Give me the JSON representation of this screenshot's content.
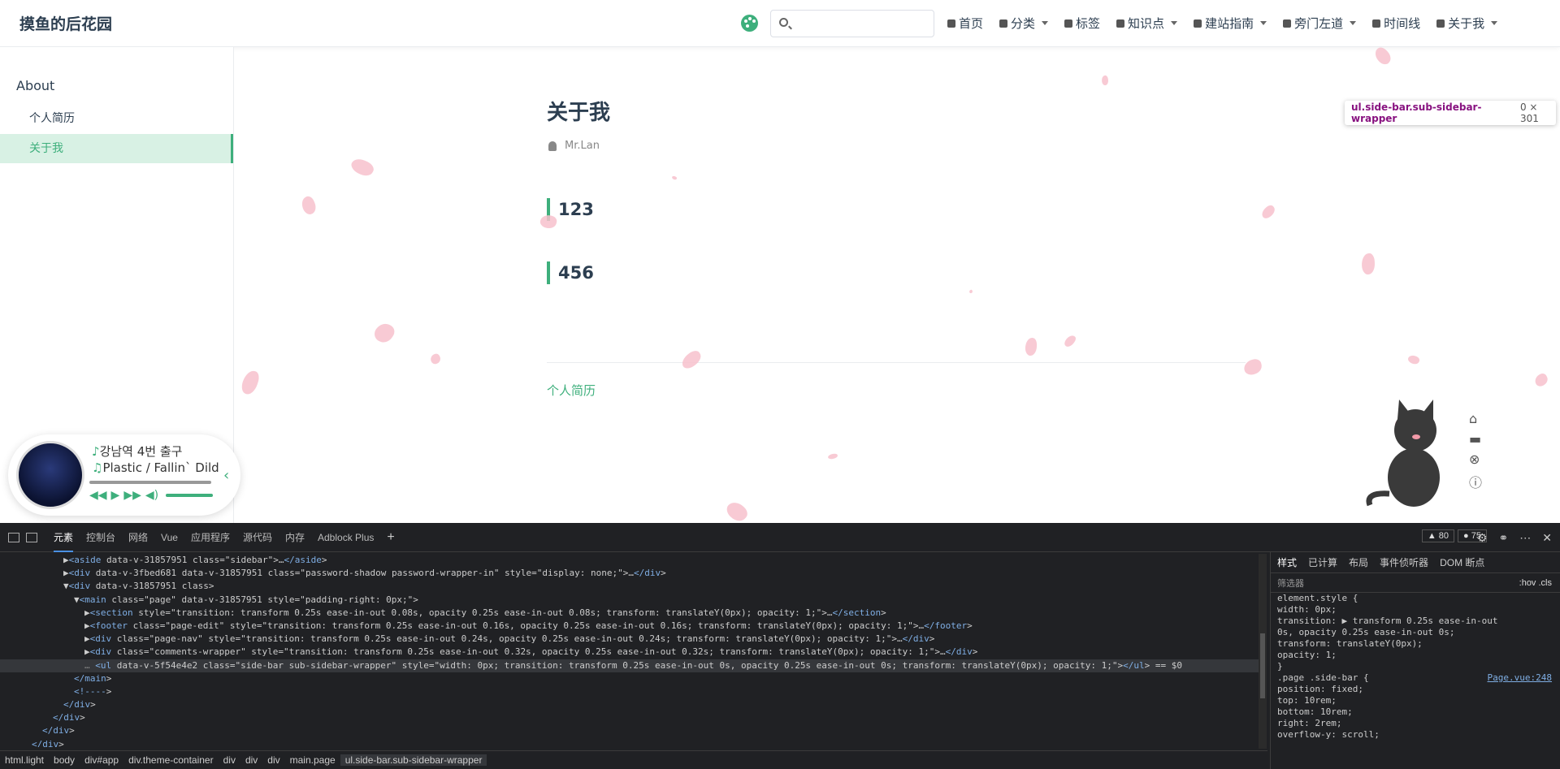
{
  "navbar": {
    "site_name": "摸鱼的后花园",
    "search_placeholder": "",
    "links": [
      {
        "label": "首页",
        "dropdown": false
      },
      {
        "label": "分类",
        "dropdown": true
      },
      {
        "label": "标签",
        "dropdown": false
      },
      {
        "label": "知识点",
        "dropdown": true
      },
      {
        "label": "建站指南",
        "dropdown": true
      },
      {
        "label": "旁门左道",
        "dropdown": true
      },
      {
        "label": "时间线",
        "dropdown": false
      },
      {
        "label": "关于我",
        "dropdown": true
      }
    ]
  },
  "sidebar": {
    "title": "About",
    "items": [
      {
        "label": "个人简历",
        "active": false
      },
      {
        "label": "关于我",
        "active": true
      }
    ]
  },
  "main": {
    "title": "关于我",
    "author": "Mr.Lan",
    "headings": [
      "123",
      "456"
    ],
    "prev_link": "个人简历"
  },
  "player": {
    "song": "강남역 4번 출구",
    "artist": "Plastic / Fallin` Dild"
  },
  "tooltip": {
    "selector": "ul.side-bar.sub-sidebar-wrapper",
    "size": "0 × 301"
  },
  "devtools": {
    "tabs": [
      "元素",
      "控制台",
      "网络",
      "Vue",
      "应用程序",
      "源代码",
      "内存",
      "Adblock Plus"
    ],
    "warnings": "80",
    "errors": "75",
    "dom_lines": [
      {
        "indent": 6,
        "html": "▶<aside data-v-31857951 class=\"sidebar\">…</aside>"
      },
      {
        "indent": 6,
        "html": "▶<div data-v-3fbed681 data-v-31857951 class=\"password-shadow password-wrapper-in\" style=\"display: none;\">…</div>"
      },
      {
        "indent": 6,
        "html": "▼<div data-v-31857951 class>"
      },
      {
        "indent": 7,
        "html": "▼<main class=\"page\" data-v-31857951 style=\"padding-right: 0px;\">"
      },
      {
        "indent": 8,
        "html": "▶<section style=\"transition: transform 0.25s ease-in-out 0.08s, opacity 0.25s ease-in-out 0.08s; transform: translateY(0px); opacity: 1;\">…</section>"
      },
      {
        "indent": 8,
        "html": "▶<footer class=\"page-edit\" style=\"transition: transform 0.25s ease-in-out 0.16s, opacity 0.25s ease-in-out 0.16s; transform: translateY(0px); opacity: 1;\">…</footer>"
      },
      {
        "indent": 8,
        "html": "▶<div class=\"page-nav\" style=\"transition: transform 0.25s ease-in-out 0.24s, opacity 0.25s ease-in-out 0.24s; transform: translateY(0px); opacity: 1;\">…</div>"
      },
      {
        "indent": 8,
        "html": "▶<div class=\"comments-wrapper\" style=\"transition: transform 0.25s ease-in-out 0.32s, opacity 0.25s ease-in-out 0.32s; transform: translateY(0px); opacity: 1;\">…</div>"
      },
      {
        "indent": 8,
        "html": "<ul data-v-5f54e4e2 class=\"side-bar sub-sidebar-wrapper\" style=\"width: 0px; transition: transform 0.25s ease-in-out 0s, opacity 0.25s ease-in-out 0s; transform: translateY(0px); opacity: 1;\"></ul> == $0",
        "selected": true
      },
      {
        "indent": 7,
        "html": "</main>"
      },
      {
        "indent": 7,
        "html": "<!---->"
      },
      {
        "indent": 6,
        "html": "</div>"
      },
      {
        "indent": 5,
        "html": "</div>"
      },
      {
        "indent": 4,
        "html": "</div>"
      },
      {
        "indent": 3,
        "html": "</div>"
      }
    ],
    "styles_tabs": [
      "样式",
      "已计算",
      "布局",
      "事件侦听器",
      "DOM 断点"
    ],
    "filter_placeholder": "筛选器",
    "filter_tools": ":hov  .cls",
    "css_lines": [
      "element.style {",
      "  width: 0px;",
      "  transition: ▶ transform 0.25s ease-in-out",
      "      0s, opacity 0.25s ease-in-out 0s;",
      "  transform: translateY(0px);",
      "  opacity: 1;",
      "}",
      ".page .side-bar {",
      "  position: fixed;",
      "  top: 10rem;",
      "  bottom: 10rem;",
      "  right: 2rem;",
      "  overflow-y: scroll;"
    ],
    "css_source": "Page.vue:248",
    "breadcrumbs": [
      "html.light",
      "body",
      "div#app",
      "div.theme-container",
      "div",
      "div",
      "div",
      "main.page",
      "ul.side-bar.sub-sidebar-wrapper"
    ]
  },
  "colors": {
    "accent": "#3eaf7c",
    "petal": "#f7c1cd",
    "devtools_bg": "#202124"
  }
}
